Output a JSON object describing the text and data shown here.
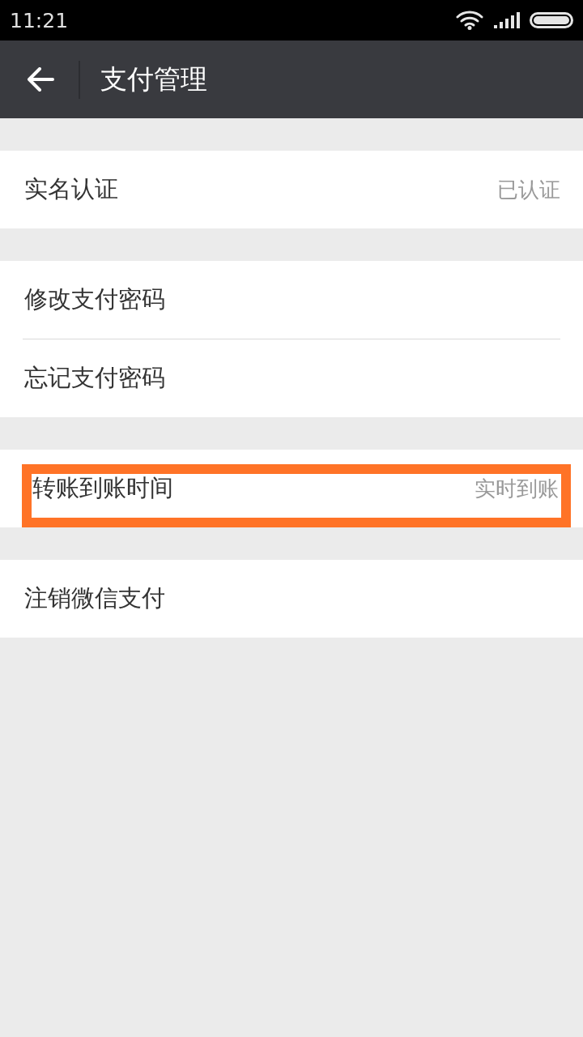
{
  "status_bar": {
    "time": "11:21"
  },
  "header": {
    "title": "支付管理"
  },
  "groups": [
    {
      "items": [
        {
          "label": "实名认证",
          "value": "已认证",
          "highlighted": false
        }
      ]
    },
    {
      "items": [
        {
          "label": "修改支付密码",
          "highlighted": false
        },
        {
          "label": "忘记支付密码",
          "highlighted": false
        }
      ]
    },
    {
      "items": [
        {
          "label": "转账到账时间",
          "value": "实时到账",
          "highlighted": true
        }
      ]
    },
    {
      "items": [
        {
          "label": "注销微信支付",
          "highlighted": false
        }
      ]
    }
  ]
}
